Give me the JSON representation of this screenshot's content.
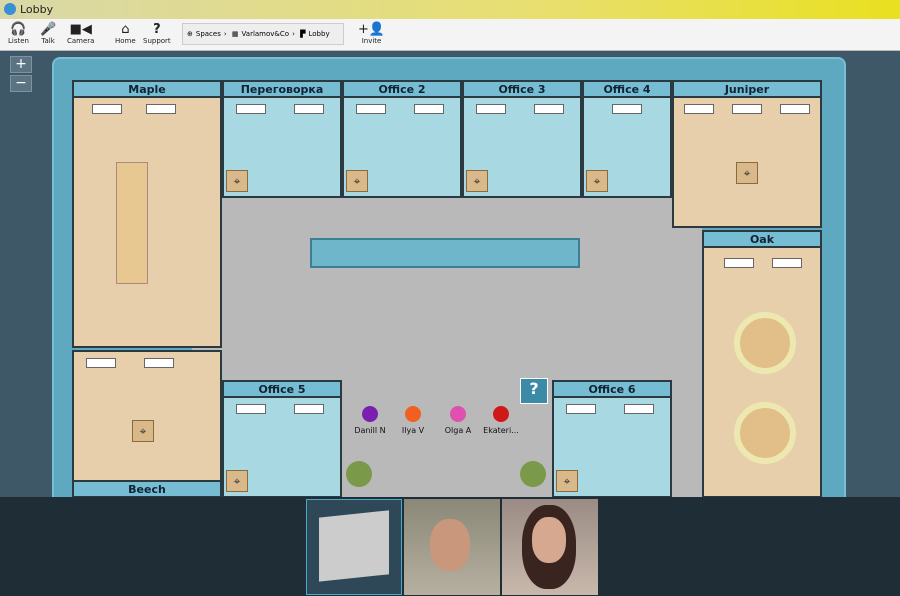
{
  "window": {
    "title": "Lobby"
  },
  "toolbar": {
    "listen": "Listen",
    "talk": "Talk",
    "camera": "Camera",
    "home": "Home",
    "support": "Support",
    "invite": "Invite"
  },
  "breadcrumb": [
    "Spaces",
    "Varlamov&Co",
    "Lobby"
  ],
  "map": {
    "zoom_in": "+",
    "zoom_out": "−",
    "help": "?",
    "rooms": {
      "maple": "Maple",
      "negotiation": "Переговорка",
      "office2": "Office 2",
      "office3": "Office 3",
      "office4": "Office 4",
      "juniper": "Juniper",
      "oak": "Oak",
      "beech": "Beech",
      "office5": "Office 5",
      "office6": "Office 6"
    }
  },
  "participants": [
    {
      "name": "Danill N",
      "color": "#7a1fb0",
      "online": true
    },
    {
      "name": "Ilya V",
      "color": "#f06020",
      "online": false
    },
    {
      "name": "Olga A",
      "color": "#e050b0",
      "online": false
    },
    {
      "name": "Ekateri...",
      "color": "#d01818",
      "online": true
    }
  ]
}
